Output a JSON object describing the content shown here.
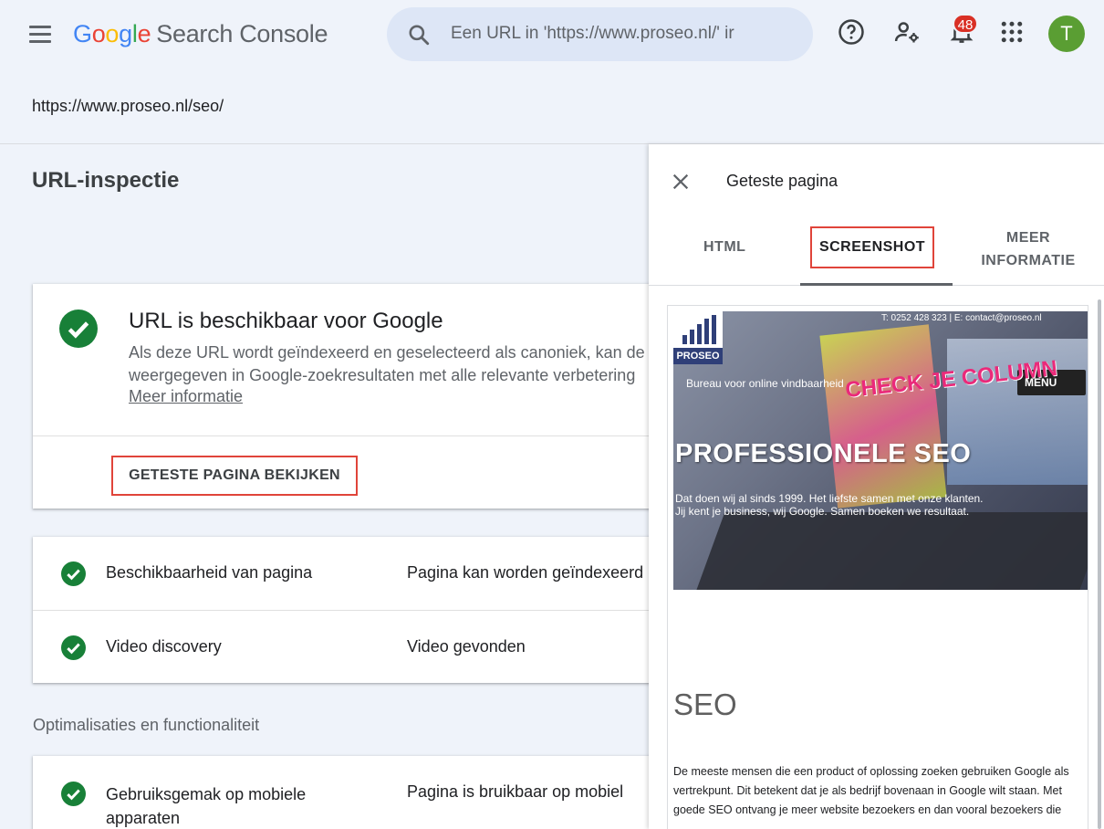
{
  "header": {
    "logo_google": [
      "G",
      "o",
      "o",
      "g",
      "l",
      "e"
    ],
    "logo_product": "Search Console",
    "search_placeholder": "Een URL in 'https://www.proseo.nl/' ir",
    "notification_count": "48",
    "avatar_initial": "T"
  },
  "property_url": "https://www.proseo.nl/seo/",
  "page_title": "URL-inspectie",
  "status_card": {
    "heading": "URL is beschikbaar voor Google",
    "description_line1": "Als deze URL wordt geïndexeerd en geselecteerd als canoniek, kan de",
    "description_line2": "weergegeven in Google-zoekresultaten met alle relevante verbetering",
    "more_link": "Meer informatie",
    "view_button": "GETESTE PAGINA BEKIJKEN"
  },
  "checks": [
    {
      "label": "Beschikbaarheid van pagina",
      "value": "Pagina kan worden geïndexeerd"
    },
    {
      "label": "Video discovery",
      "value": "Video gevonden"
    }
  ],
  "optimizations": {
    "section_label": "Optimalisaties en functionaliteit",
    "items": [
      {
        "label": "Gebruiksgemak op mobiele apparaten",
        "value": "Pagina is bruikbaar op mobiel"
      }
    ]
  },
  "panel": {
    "title": "Geteste pagina",
    "tabs": {
      "html": "HTML",
      "screenshot": "SCREENSHOT",
      "more": "MEER INFORMATIE"
    },
    "active_tab": "screenshot"
  },
  "screenshot_content": {
    "brand": "PROSEO",
    "top_line": "T: 0252 428 323  |  E: contact@proseo.nl",
    "tagline": "Bureau voor online vindbaarheid",
    "menu_label": "MENU",
    "book_text": "CHECK JE COLUMN",
    "hero_heading": "PROFESSIONELE SEO",
    "hero_sub_line1": "Dat doen wij al sinds 1999. Het liefste samen met onze klanten.",
    "hero_sub_line2": "Jij kent je business, wij Google. Samen boeken we resultaat.",
    "section_heading": "SEO",
    "body_text": "De meeste mensen die een product of oplossing zoeken gebruiken Google als vertrekpunt. Dit betekent dat je als bedrijf bovenaan in Google wilt staan. Met goede SEO ontvang je meer website bezoekers en dan vooral bezoekers die"
  },
  "colors": {
    "accent_check": "#188038",
    "highlight_box": "#e0443a",
    "badge": "#d93025",
    "avatar": "#5a9e33"
  }
}
